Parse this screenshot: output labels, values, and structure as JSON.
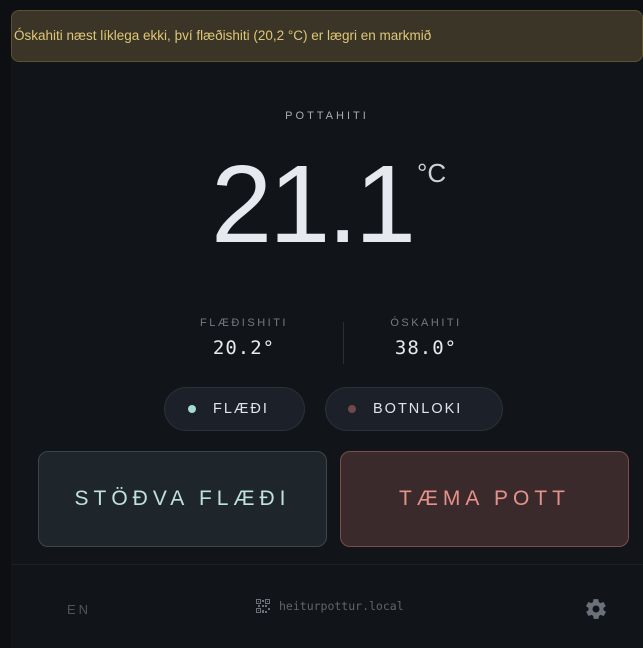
{
  "warning": {
    "text": "Óskahiti næst líklega ekki, því flæðishiti (20,2 °C) er lægri en markmið"
  },
  "pot": {
    "label": "POTTAHITI",
    "temperature": "21.1",
    "unit": "°C"
  },
  "stats": {
    "flow": {
      "label": "FLÆÐISHITI",
      "value": "20.2°"
    },
    "target": {
      "label": "ÓSKAHITI",
      "value": "38.0°"
    }
  },
  "indicators": {
    "flow": {
      "label": "FLÆÐI",
      "dot_color": "#a9d8cf",
      "active": true
    },
    "drain": {
      "label": "BOTNLOKI",
      "dot_color": "#6e4a4a",
      "active": false
    }
  },
  "actions": {
    "stop_flow": "STÖÐVA FLÆÐI",
    "empty_pot": "TÆMA POTT"
  },
  "footer": {
    "language": "EN",
    "host": "heiturpottur.local",
    "qr_icon": "qr-code-icon",
    "settings_icon": "gear-icon"
  },
  "colors": {
    "warning_bg": "#3a3526",
    "warning_text": "#e0c677",
    "stop_accent": "#bfe2da",
    "empty_accent": "#e59289"
  }
}
